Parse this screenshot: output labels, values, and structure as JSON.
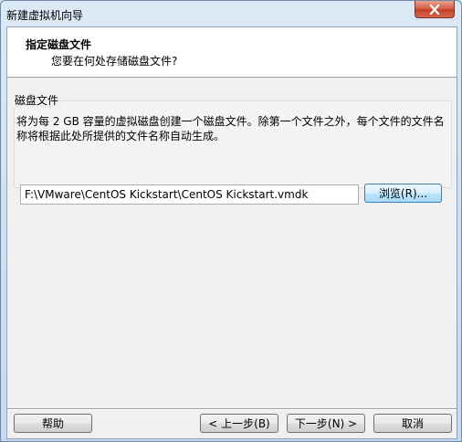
{
  "window": {
    "title": "新建虚拟机向导"
  },
  "header": {
    "title": "指定磁盘文件",
    "subtitle": "您要在何处存储磁盘文件?"
  },
  "disk_file": {
    "group_label": "磁盘文件",
    "description": "将为每 2 GB 容量的虚拟磁盘创建一个磁盘文件。除第一个文件之外，每个文件的文件名称将根据此处所提供的文件名称自动生成。",
    "path_value": "F:\\VMware\\CentOS Kickstart\\CentOS Kickstart.vmdk",
    "browse_label": "浏览(R)..."
  },
  "footer": {
    "help_label": "帮助",
    "back_label": "< 上一步(B)",
    "next_label": "下一步(N) >",
    "cancel_label": "取消"
  }
}
